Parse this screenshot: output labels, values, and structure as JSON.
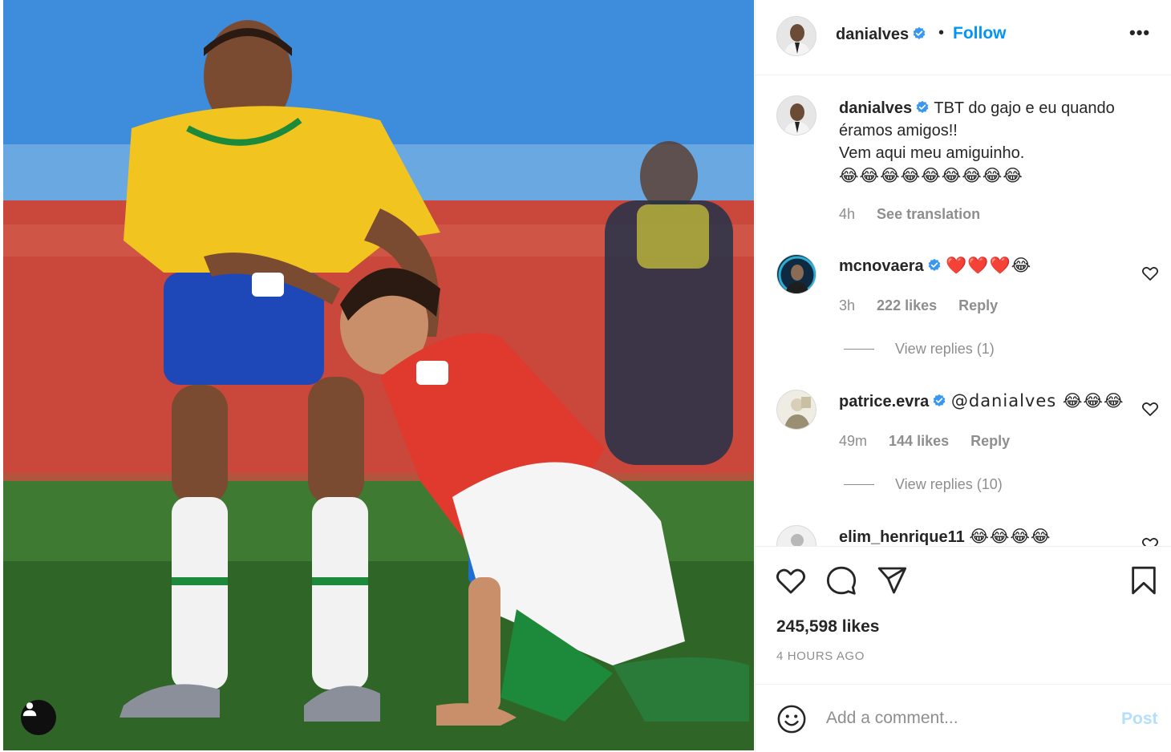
{
  "post": {
    "author": "danialves",
    "verified": true,
    "follow_label": "Follow",
    "separator": "•",
    "more_label": "•••",
    "photo_alt": ""
  },
  "caption": {
    "username": "danialves",
    "text_line1": "TBT do gajo e eu quando",
    "text_line2": "éramos amigos!!",
    "text_line3": "Vem aqui meu amiguinho.",
    "emojis": "😂😂😂😂😂😂😂😂😂",
    "time": "4h",
    "see_translation": "See translation"
  },
  "comments": [
    {
      "username": "mcnovaera",
      "verified": true,
      "text": "❤️❤️❤️😂",
      "time": "3h",
      "likes": "222 likes",
      "reply_label": "Reply",
      "view_replies": "View replies (1)"
    },
    {
      "username": "patrice.evra",
      "verified": true,
      "text": "@danialves 😂😂😂",
      "time": "49m",
      "likes": "144 likes",
      "reply_label": "Reply",
      "view_replies": "View replies (10)"
    },
    {
      "username": "elim_henrique11",
      "verified": false,
      "text": "😂😂😂😂"
    }
  ],
  "stats": {
    "likes": "245,598 likes",
    "time_ago": "4 HOURS AGO"
  },
  "composer": {
    "placeholder": "Add a comment...",
    "post_label": "Post"
  },
  "icons": {
    "like": "heart-icon",
    "comment": "comment-bubble-icon",
    "share": "paper-plane-icon",
    "save": "bookmark-icon",
    "emoji": "smiley-icon",
    "tag": "user-tag-icon"
  },
  "colors": {
    "link_blue": "#0095f6",
    "post_disabled": "#b2dffc",
    "muted": "#8e8e8e",
    "text": "#262626"
  }
}
